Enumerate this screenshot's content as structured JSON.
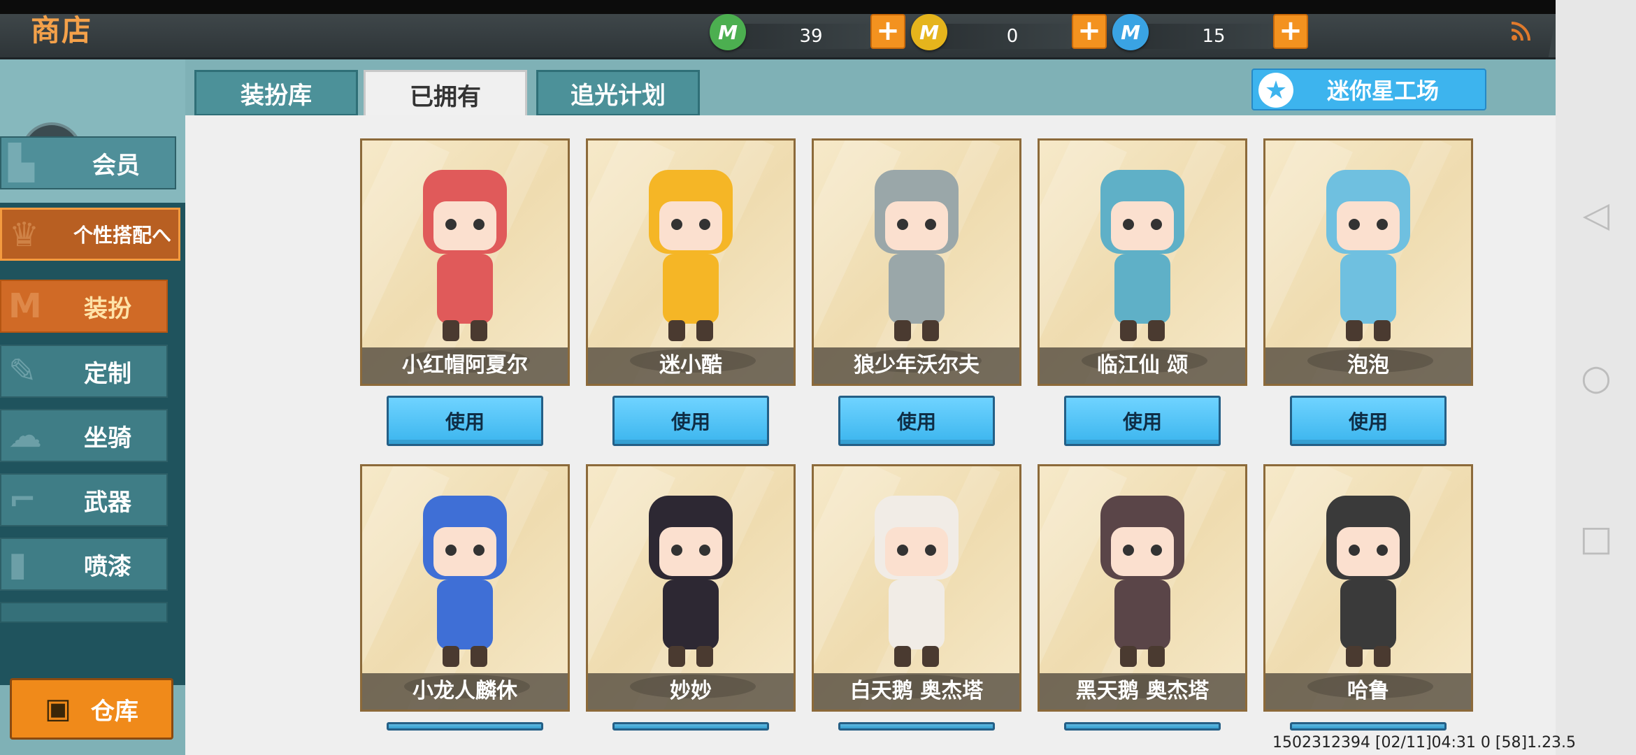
{
  "header": {
    "title": "商店",
    "currencies": [
      {
        "name": "mini-bean",
        "value": "39",
        "color": "#4caf50",
        "letter": "M"
      },
      {
        "name": "mini-coin",
        "value": "0",
        "color": "#e5b41c",
        "letter": "M"
      },
      {
        "name": "star-coin",
        "value": "15",
        "color": "#3aa3e3",
        "letter": "M"
      }
    ],
    "plus_label": "+",
    "close_label": "✕"
  },
  "sidebar": {
    "items": [
      {
        "label": "会员",
        "icon": "member-icon"
      },
      {
        "label": "个性搭配へ",
        "icon": "trophy-icon"
      },
      {
        "label": "装扮",
        "icon": "costume-icon"
      },
      {
        "label": "定制",
        "icon": "pencil-icon"
      },
      {
        "label": "坐骑",
        "icon": "mount-icon"
      },
      {
        "label": "武器",
        "icon": "gun-icon"
      },
      {
        "label": "喷漆",
        "icon": "spray-icon"
      }
    ],
    "warehouse_label": "仓库"
  },
  "tabs": [
    {
      "label": "装扮库"
    },
    {
      "label": "已拥有",
      "selected": true
    },
    {
      "label": "追光计划"
    }
  ],
  "workshop_label": "迷你星工场",
  "use_label": "使用",
  "skins": [
    {
      "name": "小红帽阿夏尔",
      "color": "#e05a5a"
    },
    {
      "name": "迷小酷",
      "color": "#f5b626"
    },
    {
      "name": "狼少年沃尔夫",
      "color": "#9aa7a9"
    },
    {
      "name": "临江仙 颂",
      "color": "#5fb0c7"
    },
    {
      "name": "泡泡",
      "color": "#6fc0e0"
    },
    {
      "name": "小龙人麟休",
      "color": "#3f6fd6"
    },
    {
      "name": "妙妙",
      "color": "#2d2833"
    },
    {
      "name": "白天鹅 奥杰塔",
      "color": "#f1ece6"
    },
    {
      "name": "黑天鹅 奥杰塔",
      "color": "#5a4548"
    },
    {
      "name": "哈鲁",
      "color": "#3a3a3a"
    }
  ],
  "footer": {
    "info": "1502312394    [02/11]04:31 0    [58]1.23.5"
  }
}
